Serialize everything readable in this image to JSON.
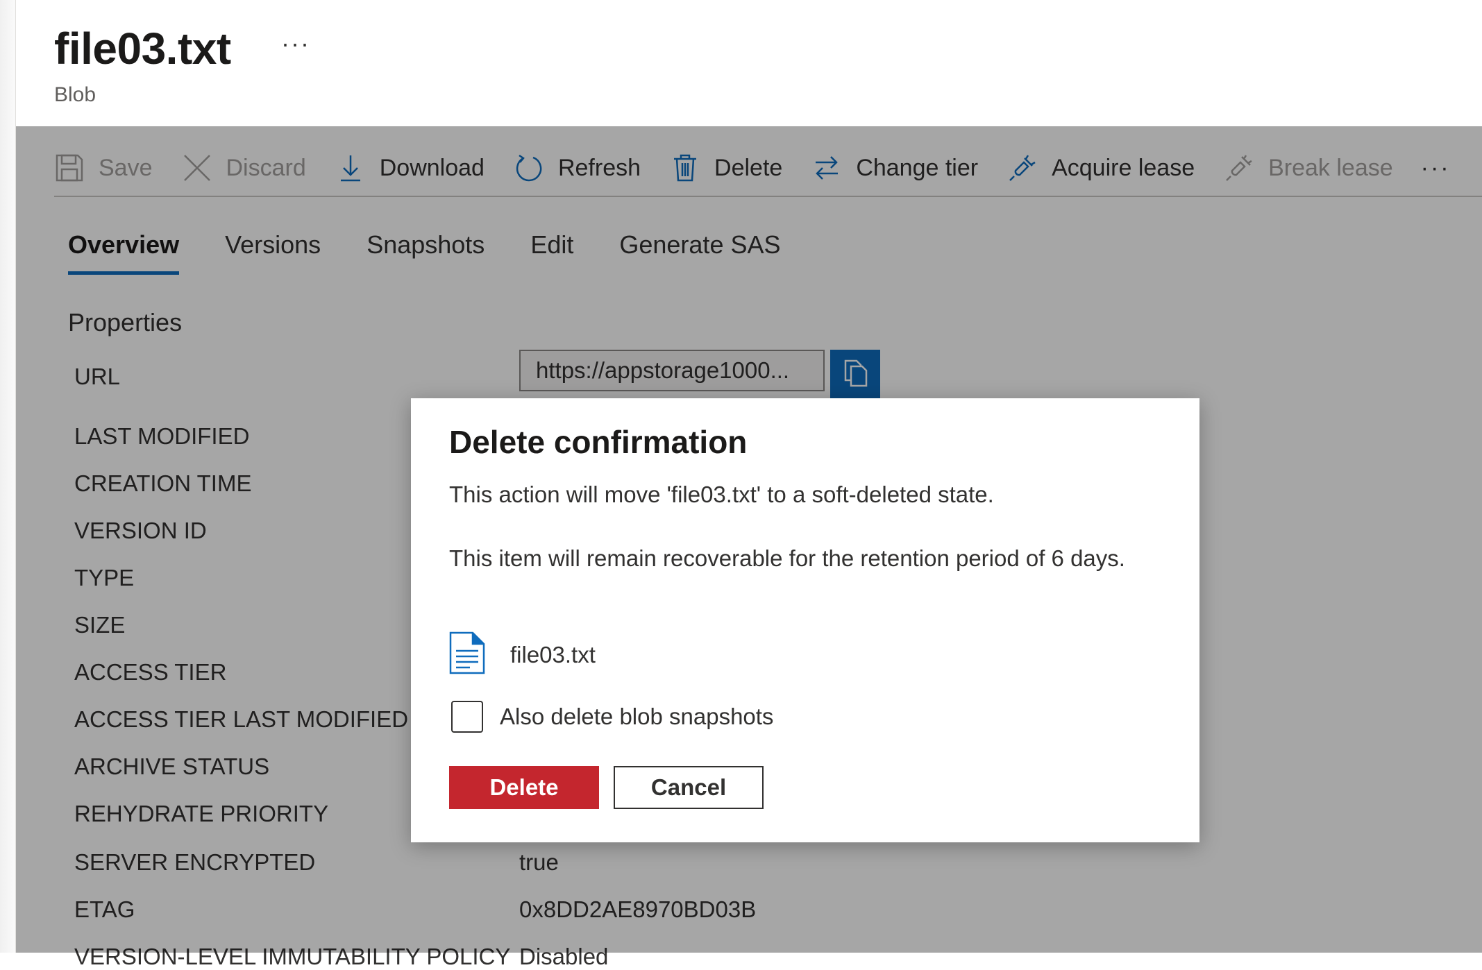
{
  "header": {
    "title": "file03.txt",
    "more": "···",
    "subtitle": "Blob"
  },
  "toolbar": {
    "save": "Save",
    "discard": "Discard",
    "download": "Download",
    "refresh": "Refresh",
    "delete": "Delete",
    "change_tier": "Change tier",
    "acquire_lease": "Acquire lease",
    "break_lease": "Break lease",
    "more": "···"
  },
  "tabs": [
    "Overview",
    "Versions",
    "Snapshots",
    "Edit",
    "Generate SAS"
  ],
  "properties": {
    "section_title": "Properties",
    "url_label": "URL",
    "url_value": "https://appstorage1000...",
    "labels": [
      "LAST MODIFIED",
      "CREATION TIME",
      "VERSION ID",
      "TYPE",
      "SIZE",
      "ACCESS TIER",
      "ACCESS TIER LAST MODIFIED",
      "ARCHIVE STATUS",
      "REHYDRATE PRIORITY",
      "SERVER ENCRYPTED",
      "ETAG",
      "VERSION-LEVEL IMMUTABILITY POLICY"
    ],
    "server_encrypted_value": "true",
    "etag_value": "0x8DD2AE8970BD03B",
    "immutability_value": "Disabled"
  },
  "dialog": {
    "title": "Delete confirmation",
    "message1": "This action will move 'file03.txt' to a soft-deleted state.",
    "message2": "This item will remain recoverable for the retention period of 6 days.",
    "file_name": "file03.txt",
    "checkbox_label": "Also delete blob snapshots",
    "checkbox_checked": false,
    "delete_label": "Delete",
    "cancel_label": "Cancel"
  },
  "colors": {
    "accent": "#0f6cbd",
    "danger": "#c4262e",
    "overlay": "rgba(0,0,0,0.35)"
  }
}
